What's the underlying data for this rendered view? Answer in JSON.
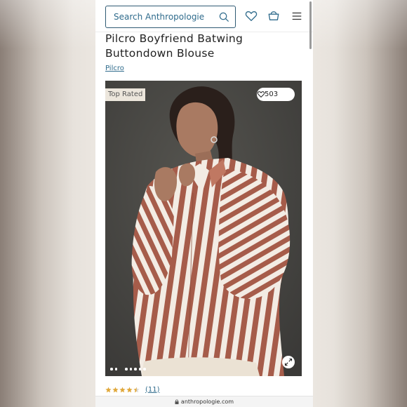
{
  "header": {
    "search_placeholder": "Search Anthropologie",
    "icons": [
      "search-icon",
      "heart-icon",
      "basket-icon",
      "hamburger-menu-icon"
    ]
  },
  "product": {
    "title_line1": "Pilcro Boyfriend Batwing",
    "title_line2": "Buttondown Blouse",
    "brand": "Pilcro",
    "badge": "Top Rated",
    "likes": "503",
    "rating": 4.5,
    "review_count": "(11)",
    "image_dots_count": 7
  },
  "browser": {
    "url": "anthropologie.com"
  },
  "colors": {
    "link": "#2f6b8c",
    "star": "#e0a83a",
    "stripe_rust": "#a65c4a",
    "stripe_cream": "#f3ece4",
    "photo_background": "#4a4a48"
  }
}
